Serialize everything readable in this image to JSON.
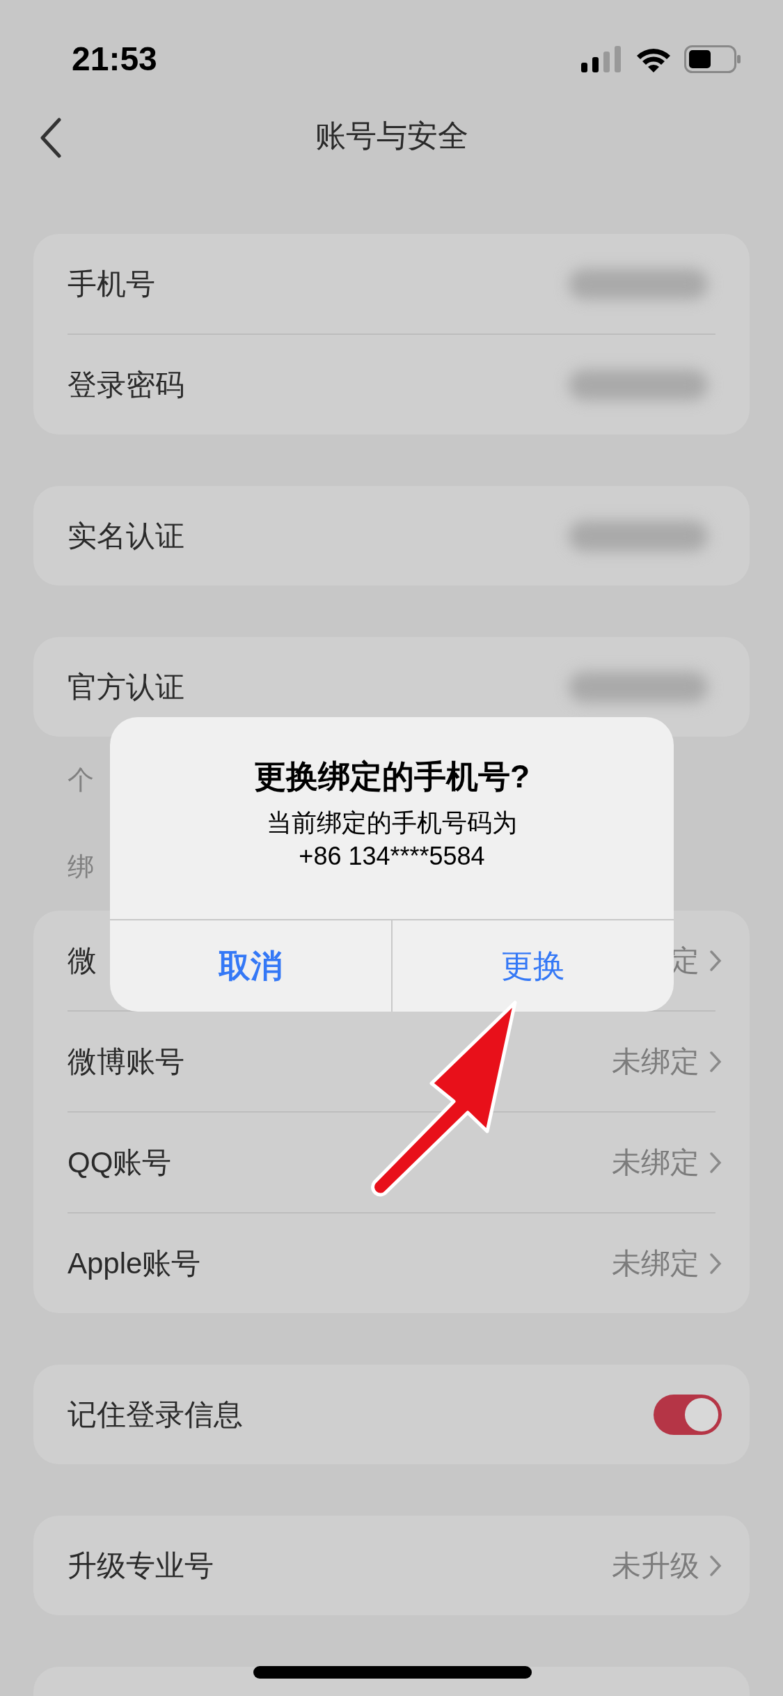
{
  "status_bar": {
    "time": "21:53"
  },
  "nav": {
    "title": "账号与安全"
  },
  "sections": [
    {
      "kind": "card",
      "rows": [
        {
          "kind": "blurred",
          "label": "手机号"
        },
        {
          "kind": "blurred",
          "label": "登录密码"
        }
      ]
    },
    {
      "kind": "card",
      "rows": [
        {
          "kind": "blurred",
          "label": "实名认证"
        }
      ]
    },
    {
      "kind": "card",
      "rows": [
        {
          "kind": "blurred",
          "label": "官方认证"
        }
      ]
    },
    {
      "kind": "caption",
      "text": "个"
    },
    {
      "kind": "caption",
      "text": "绑"
    },
    {
      "kind": "card",
      "rows": [
        {
          "kind": "link",
          "label": "微",
          "value": "定"
        },
        {
          "kind": "link",
          "label": "微博账号",
          "value": "未绑定"
        },
        {
          "kind": "link",
          "label": "QQ账号",
          "value": "未绑定"
        },
        {
          "kind": "link",
          "label": "Apple账号",
          "value": "未绑定"
        }
      ]
    },
    {
      "kind": "card",
      "rows": [
        {
          "kind": "toggle",
          "label": "记住登录信息",
          "on": true
        }
      ]
    },
    {
      "kind": "card",
      "rows": [
        {
          "kind": "link",
          "label": "升级专业号",
          "value": "未升级"
        }
      ]
    },
    {
      "kind": "card",
      "rows": [
        {
          "kind": "empty"
        }
      ]
    }
  ],
  "dialog": {
    "title": "更换绑定的手机号?",
    "message": [
      "当前绑定的手机号码为",
      "+86 134****5584"
    ],
    "buttons": [
      {
        "label": "取消",
        "bold": true
      },
      {
        "label": "更换",
        "bold": false
      }
    ]
  }
}
